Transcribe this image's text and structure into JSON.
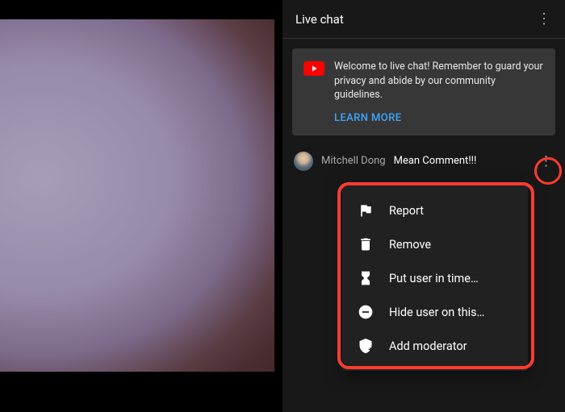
{
  "chat": {
    "title": "Live chat",
    "welcome": {
      "text": "Welcome to live chat! Remember to guard your privacy and abide by our community guidelines.",
      "learn_more": "LEARN MORE"
    },
    "message": {
      "author": "Mitchell Dong",
      "text": "Mean Comment!!!"
    }
  },
  "menu": {
    "items": [
      {
        "label": "Report"
      },
      {
        "label": "Remove"
      },
      {
        "label": "Put user in time…"
      },
      {
        "label": "Hide user on this…"
      },
      {
        "label": "Add moderator"
      }
    ]
  }
}
